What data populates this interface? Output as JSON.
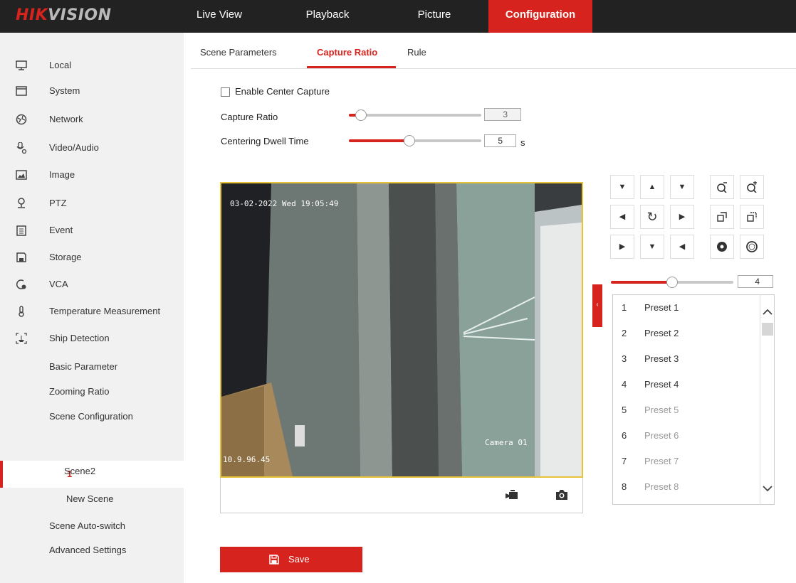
{
  "brand": {
    "logo_red": "HIK",
    "logo_gray": "VISION"
  },
  "nav": [
    "Live View",
    "Playback",
    "Picture",
    "Configuration"
  ],
  "sidebar": {
    "items": [
      "Local",
      "System",
      "Network",
      "Video/Audio",
      "Image",
      "PTZ",
      "Event",
      "Storage",
      "VCA",
      "Temperature Measurement",
      "Ship Detection"
    ],
    "icons": [
      "monitor-icon",
      "system-icon",
      "network-icon",
      "video-audio-icon",
      "image-icon",
      "ptz-icon",
      "event-icon",
      "storage-icon",
      "vca-icon",
      "temperature-icon",
      "ship-detection-icon"
    ],
    "subitems": [
      "Basic Parameter",
      "Zooming Ratio",
      "Scene Configuration"
    ],
    "scenes": [
      "1",
      "Scene2",
      "New Scene"
    ],
    "tail": [
      "Scene Auto-switch",
      "Advanced Settings"
    ]
  },
  "tabs": [
    "Scene Parameters",
    "Capture Ratio",
    "Rule"
  ],
  "form": {
    "enable_center_capture": "Enable Center Capture",
    "capture_ratio_label": "Capture Ratio",
    "capture_ratio_value": "3",
    "capture_ratio_level": 0.05,
    "dwell_label": "Centering Dwell Time",
    "dwell_value": "5",
    "dwell_unit": "s",
    "dwell_level": 0.45
  },
  "video": {
    "timestamp": "03-02-2022 Wed 19:05:49",
    "camera": "Camera 01",
    "ip": "10.9.96.45"
  },
  "ptz": {
    "speed_value": "4",
    "speed_level": 0.5
  },
  "presets": [
    {
      "n": "1",
      "name": "Preset 1",
      "set": true
    },
    {
      "n": "2",
      "name": "Preset 2",
      "set": true
    },
    {
      "n": "3",
      "name": "Preset 3",
      "set": true
    },
    {
      "n": "4",
      "name": "Preset 4",
      "set": true
    },
    {
      "n": "5",
      "name": "Preset 5",
      "set": false
    },
    {
      "n": "6",
      "name": "Preset 6",
      "set": false
    },
    {
      "n": "7",
      "name": "Preset 7",
      "set": false
    },
    {
      "n": "8",
      "name": "Preset 8",
      "set": false
    }
  ],
  "save_label": "Save",
  "colors": {
    "accent": "#d7231d",
    "topbar": "#222222",
    "sidebar": "#f1f1f1"
  }
}
